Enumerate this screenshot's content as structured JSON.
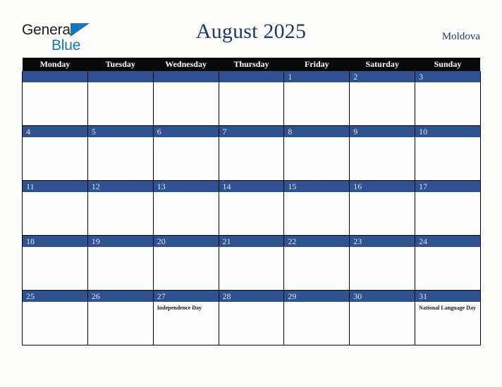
{
  "brand": {
    "word_one": "General",
    "word_two": "Blue",
    "triangle_icon": "triangle-icon",
    "color_dark": "#1b1b1b",
    "color_blue": "#1277bf"
  },
  "header": {
    "title": "August 2025",
    "country": "Moldova",
    "title_color": "#1f3864"
  },
  "calendar": {
    "weekday_headers": [
      "Monday",
      "Tuesday",
      "Wednesday",
      "Thursday",
      "Friday",
      "Saturday",
      "Sunday"
    ],
    "header_bg": "#0a0a0a",
    "daynum_bg": "#2f5293",
    "daynum_color": "#dfe4ee",
    "cell_bg": "#fdfdfd",
    "weeks": [
      [
        {
          "day": "",
          "holiday": ""
        },
        {
          "day": "",
          "holiday": ""
        },
        {
          "day": "",
          "holiday": ""
        },
        {
          "day": "",
          "holiday": ""
        },
        {
          "day": "1",
          "holiday": ""
        },
        {
          "day": "2",
          "holiday": ""
        },
        {
          "day": "3",
          "holiday": ""
        }
      ],
      [
        {
          "day": "4",
          "holiday": ""
        },
        {
          "day": "5",
          "holiday": ""
        },
        {
          "day": "6",
          "holiday": ""
        },
        {
          "day": "7",
          "holiday": ""
        },
        {
          "day": "8",
          "holiday": ""
        },
        {
          "day": "9",
          "holiday": ""
        },
        {
          "day": "10",
          "holiday": ""
        }
      ],
      [
        {
          "day": "11",
          "holiday": ""
        },
        {
          "day": "12",
          "holiday": ""
        },
        {
          "day": "13",
          "holiday": ""
        },
        {
          "day": "14",
          "holiday": ""
        },
        {
          "day": "15",
          "holiday": ""
        },
        {
          "day": "16",
          "holiday": ""
        },
        {
          "day": "17",
          "holiday": ""
        }
      ],
      [
        {
          "day": "18",
          "holiday": ""
        },
        {
          "day": "19",
          "holiday": ""
        },
        {
          "day": "20",
          "holiday": ""
        },
        {
          "day": "21",
          "holiday": ""
        },
        {
          "day": "22",
          "holiday": ""
        },
        {
          "day": "23",
          "holiday": ""
        },
        {
          "day": "24",
          "holiday": ""
        }
      ],
      [
        {
          "day": "25",
          "holiday": ""
        },
        {
          "day": "26",
          "holiday": ""
        },
        {
          "day": "27",
          "holiday": "Independence Day"
        },
        {
          "day": "28",
          "holiday": ""
        },
        {
          "day": "29",
          "holiday": ""
        },
        {
          "day": "30",
          "holiday": ""
        },
        {
          "day": "31",
          "holiday": "National Language Day"
        }
      ]
    ]
  }
}
